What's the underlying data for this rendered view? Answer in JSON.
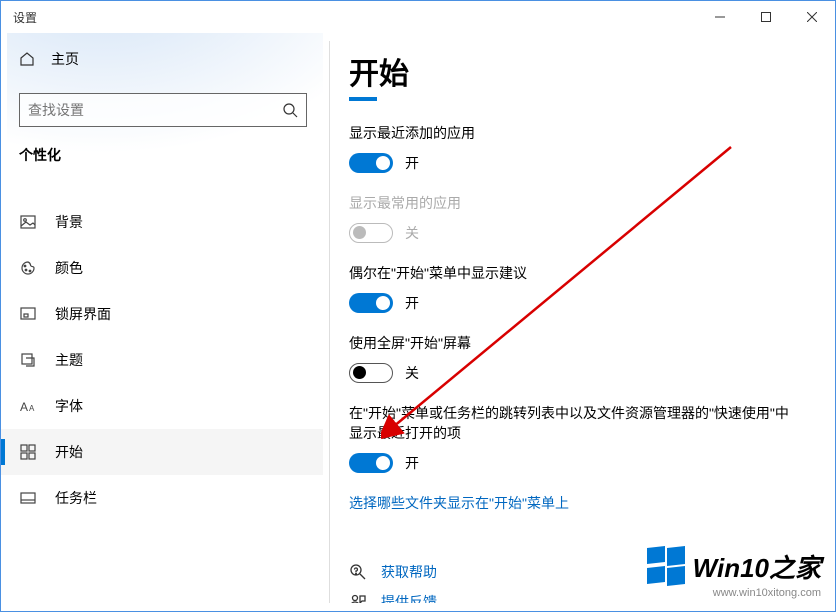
{
  "window": {
    "title": "设置"
  },
  "sidebar": {
    "home": "主页",
    "search_placeholder": "查找设置",
    "section": "个性化",
    "items": [
      {
        "label": "背景"
      },
      {
        "label": "颜色"
      },
      {
        "label": "锁屏界面"
      },
      {
        "label": "主题"
      },
      {
        "label": "字体"
      },
      {
        "label": "开始"
      },
      {
        "label": "任务栏"
      }
    ]
  },
  "main": {
    "title": "开始",
    "settings": [
      {
        "label": "显示最近添加的应用",
        "state": "on",
        "state_text": "开"
      },
      {
        "label": "显示最常用的应用",
        "state": "dis",
        "state_text": "关"
      },
      {
        "label": "偶尔在\"开始\"菜单中显示建议",
        "state": "on",
        "state_text": "开"
      },
      {
        "label": "使用全屏\"开始\"屏幕",
        "state": "off",
        "state_text": "关"
      },
      {
        "label": "在\"开始\"菜单或任务栏的跳转列表中以及文件资源管理器的\"快速使用\"中显示最近打开的项",
        "state": "on",
        "state_text": "开"
      }
    ],
    "link": "选择哪些文件夹显示在\"开始\"菜单上",
    "help": "获取帮助",
    "feedback": "提供反馈"
  },
  "watermark": {
    "brand": "Win10之家",
    "url": "www.win10xitong.com"
  }
}
